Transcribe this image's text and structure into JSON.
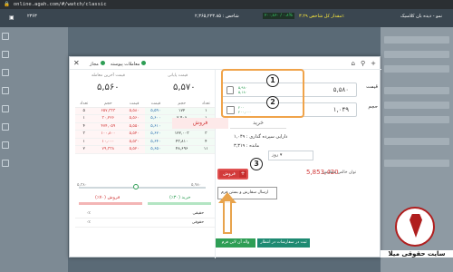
{
  "browser": {
    "url": "online.agah.com/#/watch/classic"
  },
  "topbar": {
    "index_num": "۲۳۶۳",
    "index_total": "شاخص : ۲,۳۶۵,۲۲۳.۸۵",
    "index_change": "۲۰۰,۸۶۰ / ۰.۸%",
    "index_other": "مقدار کل شاخص ۳.۲۹٪",
    "title": "نمو - دیده بان کلاسیک"
  },
  "modal": {
    "radio_series": "معاملات پیوسته",
    "radio_allowed": "مجاز",
    "buy_last_label": "قیمت آخرین معامله",
    "buy_last_price": "۵,۵۶۰",
    "final_label": "قیمت پایانی",
    "final_price": "۵,۵۷۰",
    "book_headers": [
      "تعداد",
      "حجم",
      "قیمت",
      "قیمت",
      "حجم",
      "تعداد"
    ],
    "book_rows": [
      [
        "۵",
        "۶۵۷,۳۳۳",
        "۵,۵۸۰",
        "۵,۵۹۰",
        "۱۷۲",
        "۱"
      ],
      [
        "۱",
        "۳۰,۲۲۶",
        "۵,۵۶۰",
        "۵,۶۰۰",
        "۲,۴۰۶",
        "۱"
      ],
      [
        "۴",
        "۴۷۴,۰۵۹",
        "۵,۵۵۰",
        "۵,۶۱۰",
        "۱,۰۰۰",
        "۲"
      ],
      [
        "۳",
        "۱۰۰,۸۰۰",
        "۵,۵۴۰",
        "۵,۶۲۰",
        "۱۲۲,۰۰۳",
        "۳"
      ],
      [
        "۱",
        "۱۰,۰۰۰",
        "۵,۵۳۰",
        "۵,۶۴۰",
        "۴۳,۸۱۰",
        "۴"
      ],
      [
        "۲",
        "۷۹,۳۳۸",
        "۵,۵۲۰",
        "۵,۶۵۰",
        "۴۸,۶۹۶",
        "۱۱"
      ]
    ],
    "slider_min": "۵,۳۸۰",
    "slider_max": "۵,۹۸۰",
    "sell_bar_label": "فروش (۷۰٪)",
    "buy_bar_label": "خرید (۳۰٪)",
    "inst_rows": [
      {
        "left": "۰٪",
        "right": "حقیقی"
      },
      {
        "left": "۰٪",
        "right": "حقوقی"
      }
    ],
    "price_field_label": "قیمت",
    "price_field_value": "۵,۵۸۰",
    "price_mini": [
      "۵,۹۸۰",
      "۵,۱۸۰"
    ],
    "volume_field_label": "حجم",
    "volume_field_value": "۱,۰۴۹",
    "volume_mini": [
      "۲۰۰",
      "۲۰۰,۰۰۰"
    ],
    "badge1": "1",
    "badge2": "2",
    "badge3": "3",
    "tab_buy": "خرید",
    "tab_sell": "فروش",
    "assets_label": "دارایی سپرده گذاری : ۱,۰۴۹",
    "remain_label": "مانده : ۳,۳۱۹",
    "dropdown_value": "روز",
    "credit_label": "توان خالص سفارش",
    "credit_value": "5,853,420",
    "sell_button": "فروش",
    "plus_button": "+",
    "tooltip": "ارسال سفارش و بستن فرم",
    "bottom_btn_1": "والد آن لاین فرم",
    "bottom_btn_2": "ثبت در سفارشات در انتظار"
  },
  "watermark": {
    "text": "سایت حقوقی میلا"
  }
}
